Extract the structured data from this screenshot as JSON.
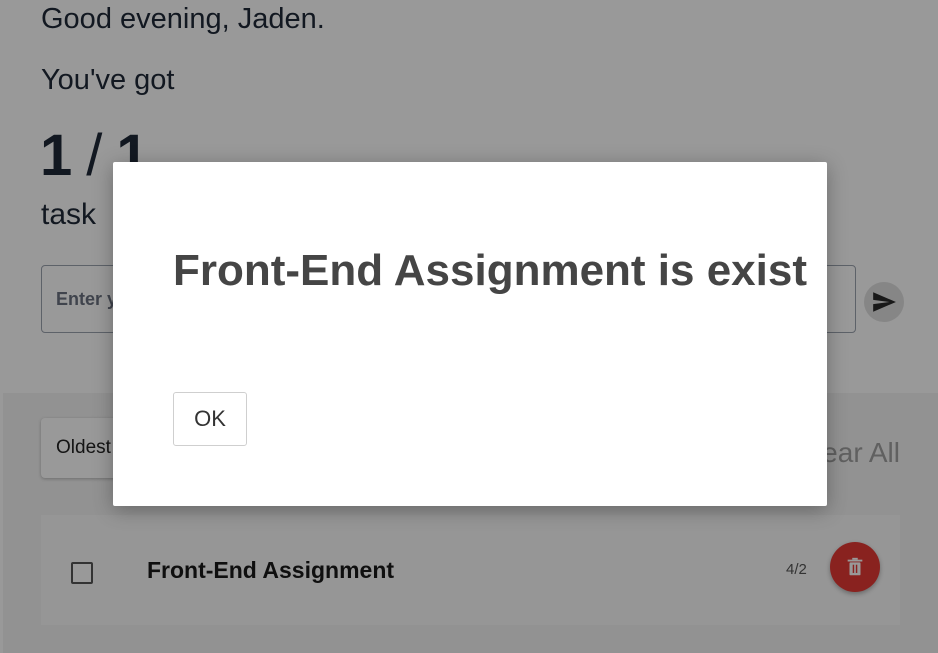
{
  "header": {
    "greeting": "Good evening, Jaden.",
    "subtitle": "You've got",
    "counter": {
      "done": "1",
      "separator": "/",
      "total": "1"
    },
    "task_label": "task"
  },
  "new_task": {
    "placeholder": "Enter your task",
    "send_icon": "send-icon"
  },
  "list": {
    "sort": {
      "selected": "Oldest"
    },
    "clear_all_label": "Clear All",
    "tasks": [
      {
        "title": "Front-End Assignment",
        "date": "4/2",
        "done": false
      }
    ]
  },
  "dialog": {
    "message": "Front-End Assignment is exist",
    "ok_label": "OK"
  },
  "colors": {
    "delete": "#e53935",
    "overlay": "rgba(0,0,0,0.4)"
  }
}
